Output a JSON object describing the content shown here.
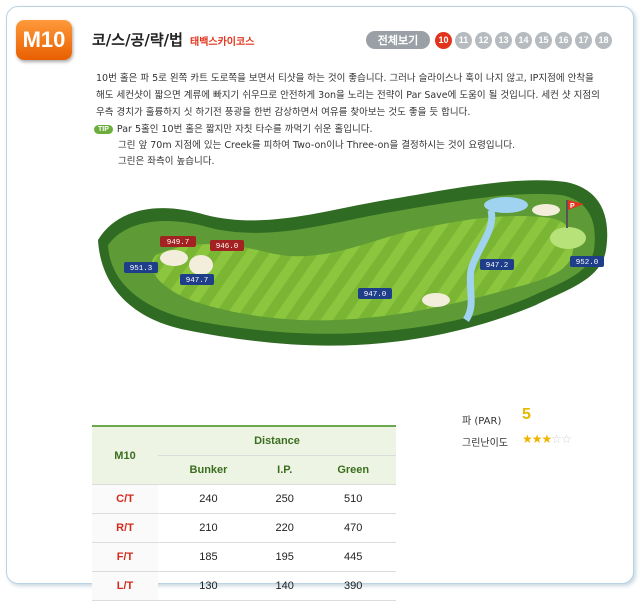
{
  "header": {
    "hole_badge": "M10",
    "title": "코/스/공/략/법",
    "subtitle": "태백스카이코스",
    "view_all": "전체보기",
    "holes": [
      "10",
      "11",
      "12",
      "13",
      "14",
      "15",
      "16",
      "17",
      "18"
    ],
    "active_hole": "10"
  },
  "description": [
    "10번 홀은 파 5로 왼쪽 카트 도로쪽을 보면서 티샷을 하는 것이 좋습니다. 그러나 슬라이스나 훅이 나지 않고, IP지점에 안착을",
    "해도 세컨샷이 짧으면 계류에 빠지기 쉬우므로 안전하게 3on을 노리는 전략이 Par Save에 도움이 될 것입니다. 세컨 샷 지점의",
    "우측 경치가 훌륭하지 싯 하기전 풍광을 한번 감상하면서 여유를 찾아보는 것도 좋을 듯 합니다."
  ],
  "tip": {
    "badge": "TIP",
    "lines": [
      "Par 5홀인 10번 홀은 짧지만 자칫 타수를 까먹기 쉬운 홀입니다.",
      "그린 앞 70m 지점에 있는 Creek를 피하여 Two-on이나 Three-on을 결정하시는 것이 요령입니다.",
      "그린은 좌측이 높습니다."
    ]
  },
  "map": {
    "markers": [
      "949.7",
      "946.0",
      "951.3",
      "947.7",
      "947.0",
      "947.2",
      "952.0"
    ],
    "flag": "P"
  },
  "info": {
    "par_label": "파 (PAR)",
    "par_value": "5",
    "difficulty_label": "그린난이도",
    "difficulty": 3,
    "difficulty_max": 5
  },
  "table": {
    "hole_label": "M10",
    "group_header": "Distance",
    "columns": [
      "Bunker",
      "I.P.",
      "Green"
    ],
    "rows": [
      {
        "tee": "C/T",
        "values": [
          "240",
          "250",
          "510"
        ]
      },
      {
        "tee": "R/T",
        "values": [
          "210",
          "220",
          "470"
        ]
      },
      {
        "tee": "F/T",
        "values": [
          "185",
          "195",
          "445"
        ]
      },
      {
        "tee": "L/T",
        "values": [
          "130",
          "140",
          "390"
        ]
      }
    ]
  },
  "colors": {
    "accent": "#e2341d",
    "badge": "#f07a10",
    "green": "#6aa84f"
  }
}
